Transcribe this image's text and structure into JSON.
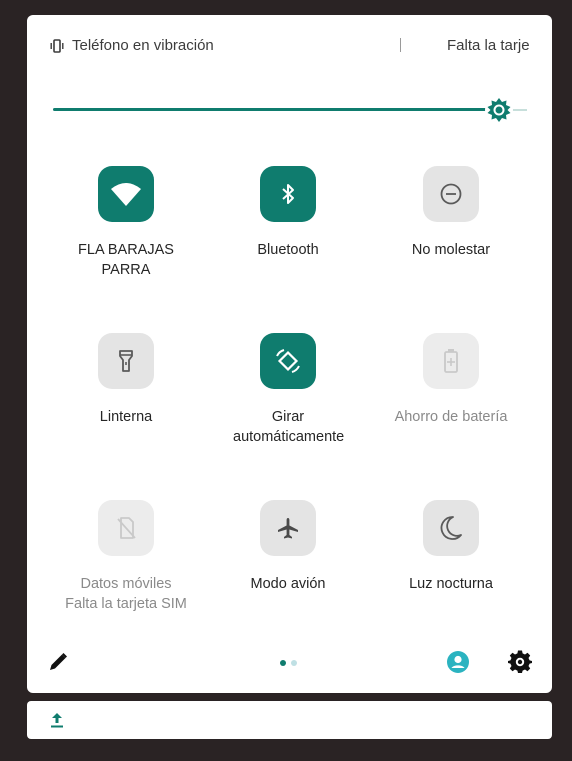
{
  "status": {
    "vibration_text": "Teléfono en vibración",
    "sim_text": "Falta la tarje"
  },
  "brightness": {
    "level": 0.97
  },
  "tiles": [
    {
      "label": "FLA BARAJAS PARRA",
      "icon": "wifi-icon",
      "state": "on"
    },
    {
      "label": "Bluetooth",
      "icon": "bluetooth-icon",
      "state": "on"
    },
    {
      "label": "No molestar",
      "icon": "do-not-disturb-icon",
      "state": "off"
    },
    {
      "label": "Linterna",
      "icon": "flashlight-icon",
      "state": "off"
    },
    {
      "label": "Girar automáticamente",
      "icon": "auto-rotate-icon",
      "state": "on"
    },
    {
      "label": "Ahorro de batería",
      "icon": "battery-saver-icon",
      "state": "disabled"
    },
    {
      "label": "Datos móviles\nFalta la tarjeta SIM",
      "icon": "mobile-data-icon",
      "state": "disabled"
    },
    {
      "label": "Modo avión",
      "icon": "airplane-icon",
      "state": "off"
    },
    {
      "label": "Luz nocturna",
      "icon": "night-light-icon",
      "state": "off"
    }
  ],
  "pager": {
    "pages": 2,
    "current": 1
  },
  "colors": {
    "accent": "#0f7c6e",
    "accent_light": "#2bb3c0"
  }
}
